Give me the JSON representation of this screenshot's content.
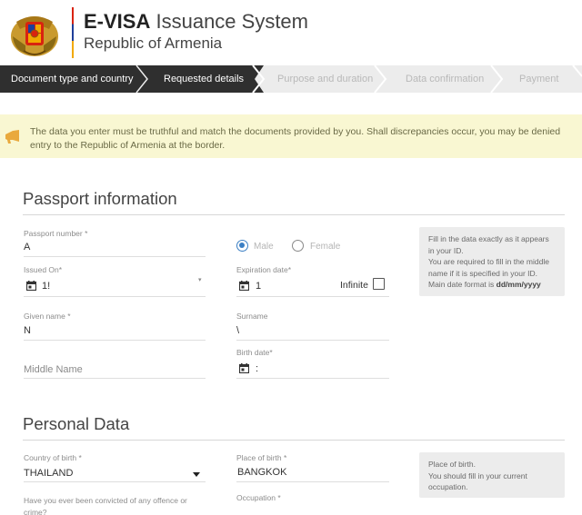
{
  "header": {
    "title_bold": "E-VISA",
    "title_rest": "Issuance System",
    "subtitle": "Republic of Armenia"
  },
  "steps": [
    {
      "label": "Document type and country",
      "state": "active"
    },
    {
      "label": "Requested details",
      "state": "active"
    },
    {
      "label": "Purpose and duration",
      "state": "inactive"
    },
    {
      "label": "Data confirmation",
      "state": "inactive"
    },
    {
      "label": "Payment",
      "state": "inactive"
    }
  ],
  "notice": {
    "text": "The data you enter must be truthful and match the documents provided by you. Shall discrepancies occur, you may be denied entry to the Republic of Armenia at the border."
  },
  "passport": {
    "section_title": "Passport information",
    "passport_number_label": "Passport number *",
    "passport_number_value": "A",
    "sex_male_label": "Male",
    "sex_female_label": "Female",
    "sex_selected": "Male",
    "issued_on_label": "Issued On*",
    "issued_on_value": "1!",
    "expiration_label": "Expiration date*",
    "expiration_value": "1",
    "infinite_label": "Infinite",
    "given_name_label": "Given name *",
    "given_name_value": "N",
    "surname_label": "Surname",
    "surname_value": "\\",
    "middle_name_placeholder": "Middle Name",
    "birth_date_label": "Birth date*",
    "birth_date_value": ":",
    "hint": {
      "line1": "Fill in the data exactly as it appears in your ID.",
      "line2": "You are required to fill in the middle name if it is specified in your ID.",
      "line3_prefix": "Main date format is ",
      "line3_bold": "dd/mm/yyyy"
    }
  },
  "personal": {
    "section_title": "Personal Data",
    "country_of_birth_label": "Country of birth *",
    "country_of_birth_value": "THAILAND",
    "place_of_birth_label": "Place of birth *",
    "place_of_birth_value": "BANGKOK",
    "conviction_label": "Have you ever been convicted of any offence or crime?",
    "occupation_label": "Occupation *",
    "hint": {
      "line1": "Place of birth.",
      "line2": "You should fill in your current occupation."
    }
  },
  "colors": {
    "active_step_bg": "#2f2f2f",
    "inactive_step_bg": "#ececec",
    "notice_bg": "#f9f7d2",
    "radio_accent": "#3b7fc4"
  }
}
